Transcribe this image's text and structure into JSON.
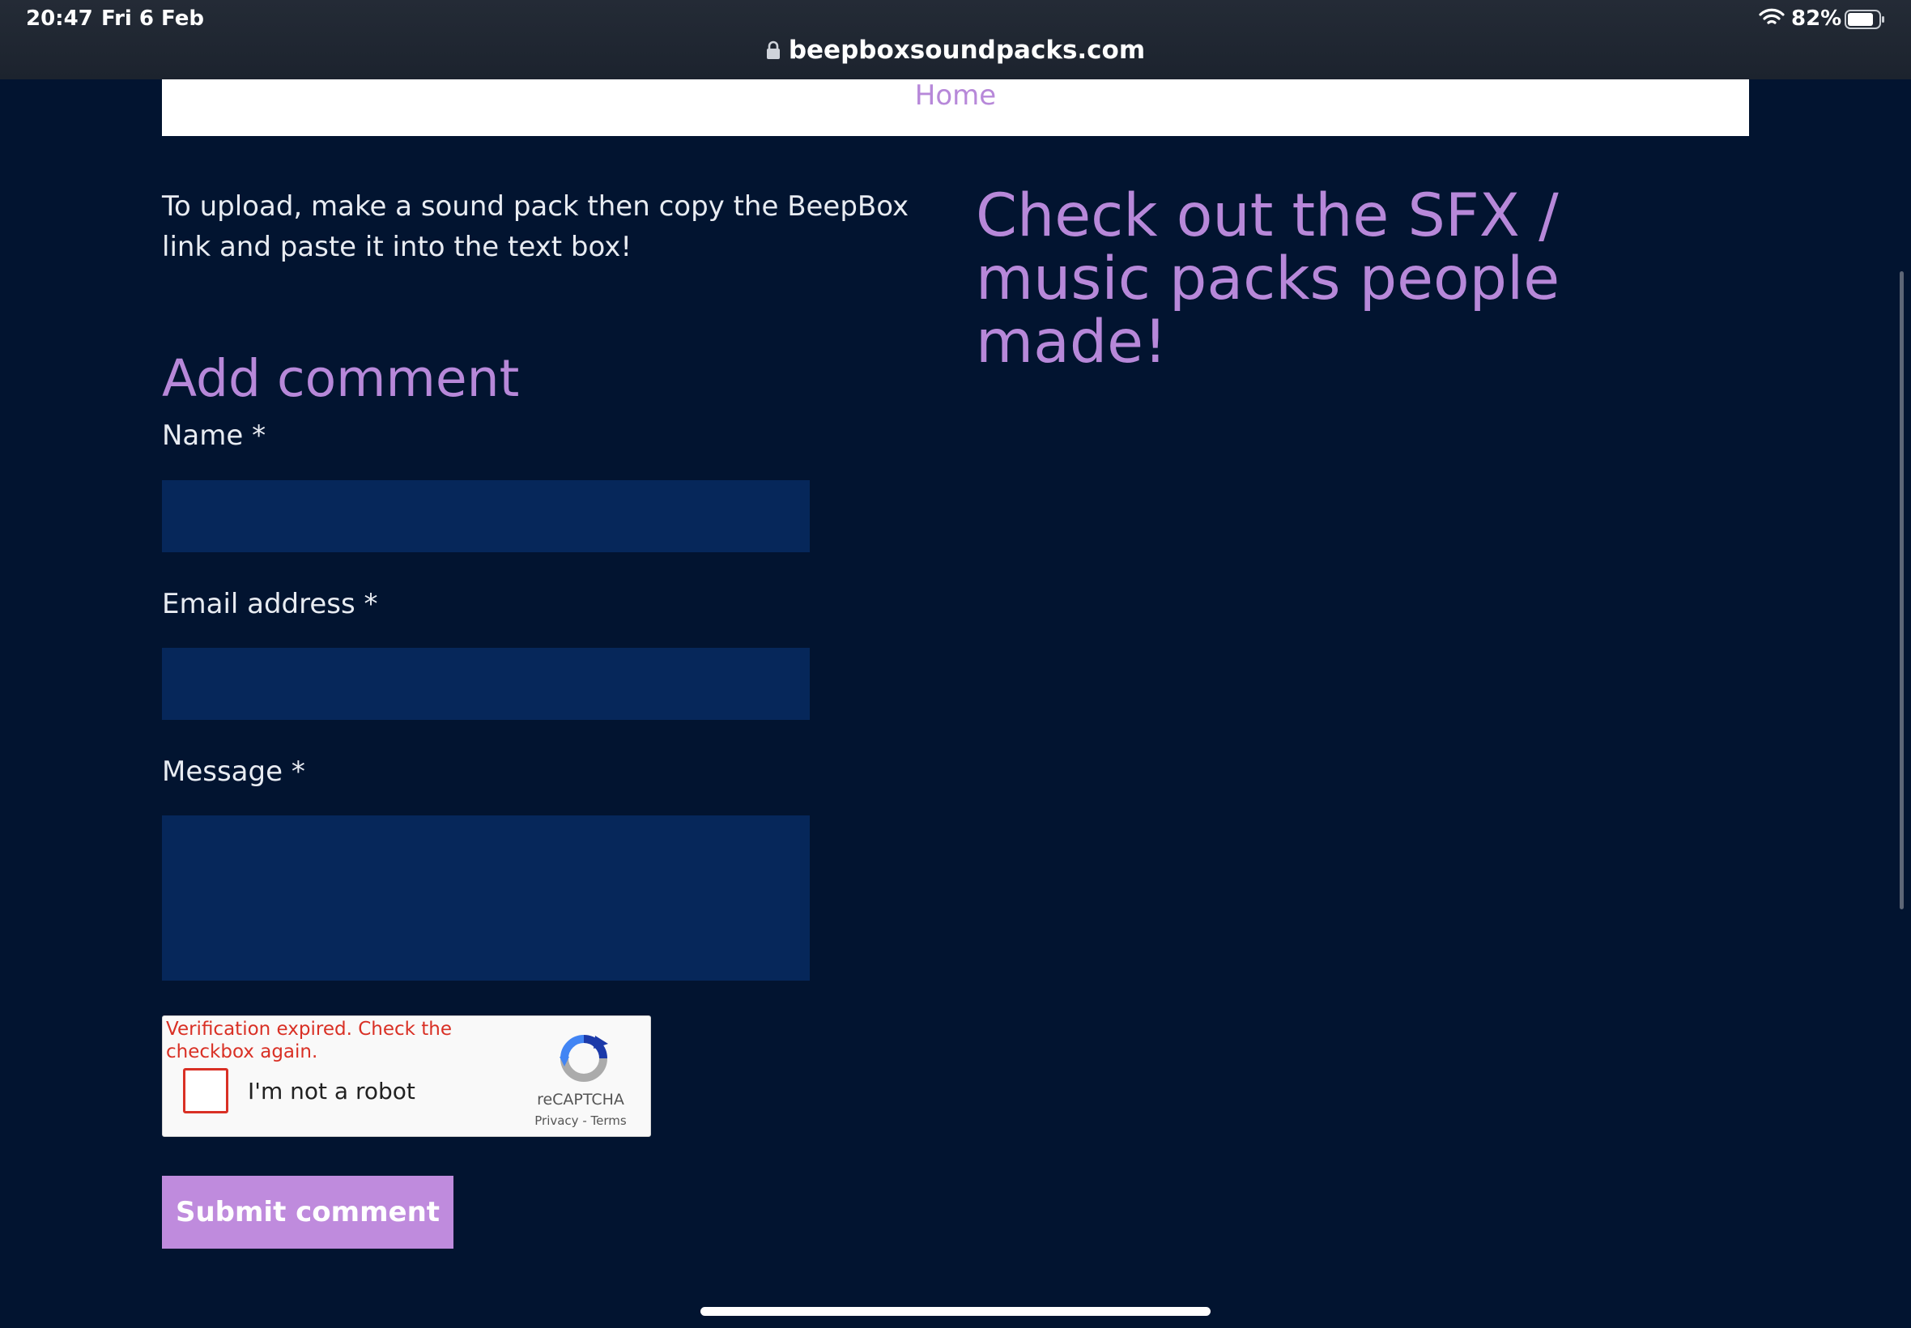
{
  "status_bar": {
    "time": "20:47",
    "date": "Fri 6 Feb",
    "battery": "82%",
    "wifi_icon": "wifi-icon",
    "battery_icon": "battery-icon"
  },
  "browser": {
    "url": "beepboxsoundpacks.com",
    "lock_icon": "lock-icon"
  },
  "nav": {
    "home": "Home"
  },
  "intro_text": "To upload, make a sound pack then copy the BeepBox link  and paste it into the text box!",
  "promo_heading": "Check out the SFX / music packs people made!",
  "comment_form": {
    "heading": "Add comment",
    "name_label": "Name *",
    "name_value": "",
    "email_label": "Email address *",
    "email_value": "",
    "message_label": "Message *",
    "message_value": "",
    "submit_label": "Submit comment"
  },
  "recaptcha": {
    "error": "Verification expired. Check the checkbox again.",
    "checkbox_label": "I'm not a robot",
    "brand": "reCAPTCHA",
    "privacy": "Privacy",
    "separator": "-",
    "terms": "Terms"
  },
  "colors": {
    "page_background": "#021430",
    "accent": "#b788d9",
    "field_background": "#06275a",
    "submit_background": "#bf8bdd",
    "error": "#d93025"
  }
}
